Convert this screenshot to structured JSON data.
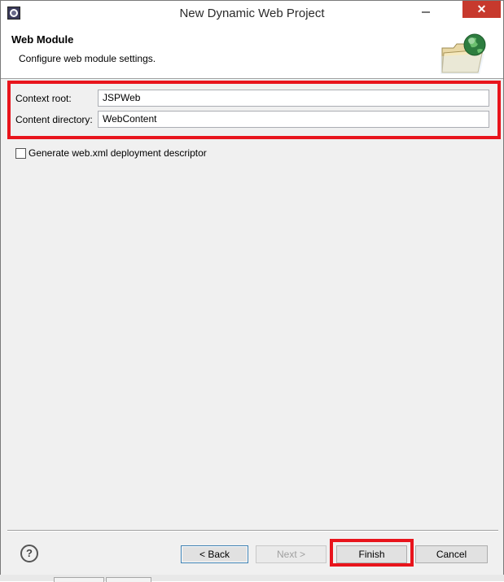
{
  "window": {
    "title": "New Dynamic Web Project",
    "close_label": "✕",
    "accent_color": "#e8141c"
  },
  "banner": {
    "title": "Web Module",
    "description": "Configure web module settings."
  },
  "form": {
    "context_root_label": "Context root:",
    "context_root_value": "JSPWeb",
    "content_directory_label": "Content directory:",
    "content_directory_value": "WebContent",
    "generate_descriptor_label": "Generate web.xml deployment descriptor",
    "generate_descriptor_checked": false
  },
  "footer": {
    "help_icon": "?",
    "back_label": "< Back",
    "next_label": "Next >",
    "finish_label": "Finish",
    "cancel_label": "Cancel"
  }
}
